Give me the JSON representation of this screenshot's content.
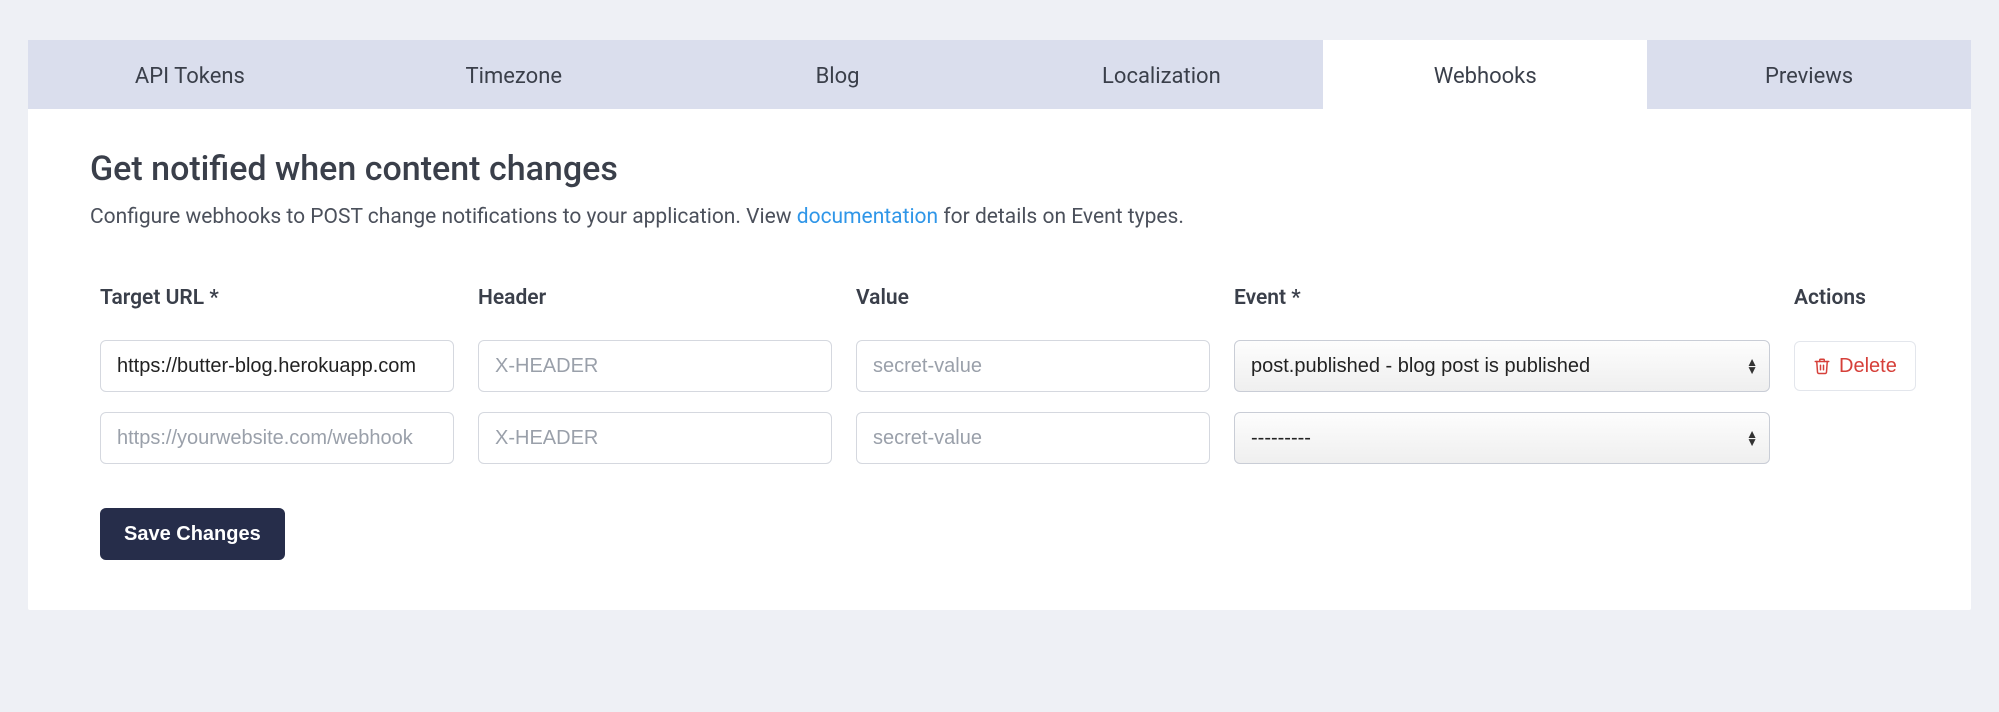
{
  "tabs": {
    "items": [
      {
        "label": "API Tokens",
        "active": false
      },
      {
        "label": "Timezone",
        "active": false
      },
      {
        "label": "Blog",
        "active": false
      },
      {
        "label": "Localization",
        "active": false
      },
      {
        "label": "Webhooks",
        "active": true
      },
      {
        "label": "Previews",
        "active": false
      }
    ]
  },
  "header": {
    "title": "Get notified when content changes",
    "subtitle_prefix": "Configure webhooks to POST change notifications to your application. View ",
    "subtitle_link": "documentation",
    "subtitle_suffix": " for details on Event types."
  },
  "columns": {
    "target_url": "Target URL *",
    "header": "Header",
    "value": "Value",
    "event": "Event *",
    "actions": "Actions"
  },
  "rows": [
    {
      "target_url_value": "https://butter-blog.herokuapp.com",
      "target_url_placeholder": "https://yourwebsite.com/webhook",
      "header_value": "",
      "header_placeholder": "X-HEADER",
      "value_value": "",
      "value_placeholder": "secret-value",
      "event_value": "post.published - blog post is published",
      "show_delete": true
    },
    {
      "target_url_value": "",
      "target_url_placeholder": "https://yourwebsite.com/webhook",
      "header_value": "",
      "header_placeholder": "X-HEADER",
      "value_value": "",
      "value_placeholder": "secret-value",
      "event_value": "---------",
      "show_delete": false
    }
  ],
  "actions": {
    "delete_label": "Delete",
    "save_label": "Save Changes"
  }
}
